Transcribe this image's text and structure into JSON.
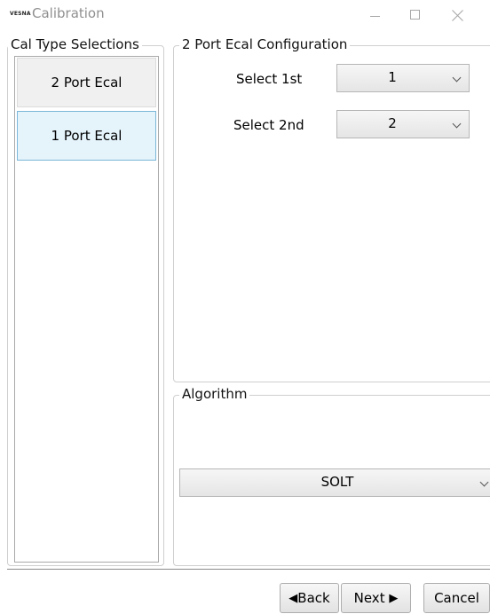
{
  "window": {
    "logo_text": "VESNA",
    "title": "Calibration",
    "controls": [
      "minimize-icon",
      "maximize-icon",
      "close-icon"
    ]
  },
  "cal_type": {
    "legend": "Cal Type Selections",
    "items": [
      {
        "label": "2 Port Ecal",
        "selected": false
      },
      {
        "label": "1 Port Ecal",
        "selected": true
      }
    ]
  },
  "config": {
    "legend": "2 Port Ecal Configuration",
    "select_first_label": "Select 1st",
    "select_first_value": "1",
    "select_second_label": "Select 2nd",
    "select_second_value": "2"
  },
  "algorithm": {
    "legend": "Algorithm",
    "value": "SOLT"
  },
  "buttons": {
    "back_arrow": "◀",
    "back_label": "Back",
    "next_label": "Next",
    "next_arrow": "▶",
    "cancel_label": "Cancel"
  },
  "colors": {
    "selected_item_bg": "#e5f3fb",
    "selected_item_border": "#7ab7d8",
    "button_bg": "#e8e8e8"
  }
}
